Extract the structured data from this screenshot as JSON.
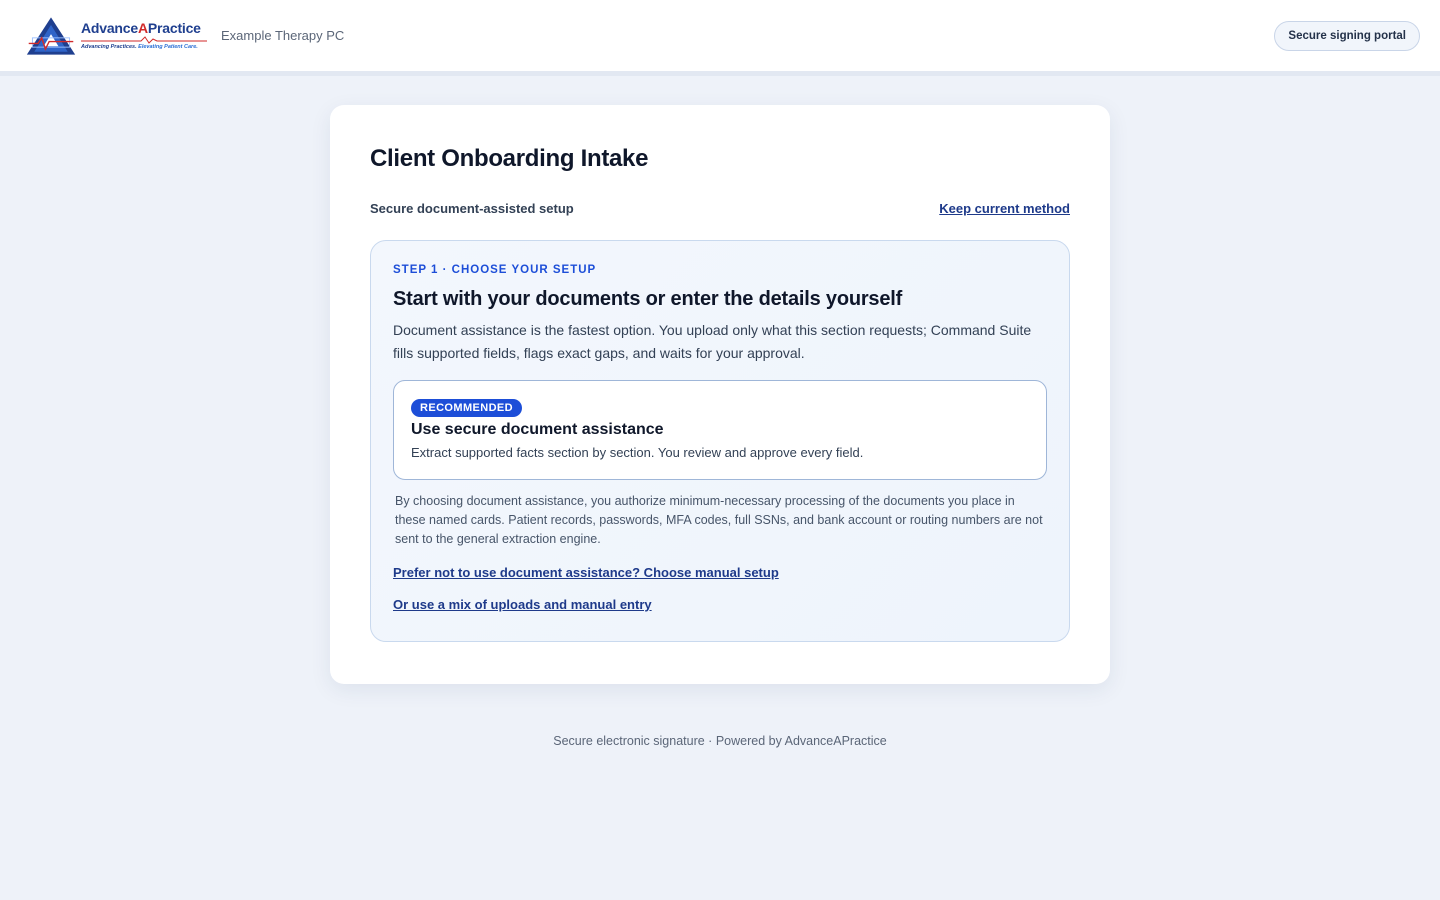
{
  "header": {
    "logo": {
      "name_part1": "Advance",
      "name_part2": "A",
      "name_part3": "Practice",
      "tagline_part1": "Advancing Practices.",
      "tagline_part2": "Elevating Patient Care."
    },
    "org_name": "Example Therapy PC",
    "portal_badge": "Secure signing portal"
  },
  "card": {
    "title": "Client Onboarding Intake",
    "subhead": "Secure document-assisted setup",
    "keep_link": "Keep current method",
    "step": {
      "label": "STEP 1 · CHOOSE YOUR SETUP",
      "heading": "Start with your documents or enter the details yourself",
      "description": "Document assistance is the fastest option. You upload only what this section requests; Command Suite fills supported fields, flags exact gaps, and waits for your approval.",
      "option": {
        "badge": "RECOMMENDED",
        "title": "Use secure document assistance",
        "description": "Extract supported facts section by section. You review and approve every field."
      },
      "consent": "By choosing document assistance, you authorize minimum-necessary processing of the documents you place in these named cards. Patient records, passwords, MFA codes, full SSNs, and bank account or routing numbers are not sent to the general extraction engine.",
      "manual_link": "Prefer not to use document assistance? Choose manual setup",
      "mix_link": "Or use a mix of uploads and manual entry"
    }
  },
  "footer": {
    "text": "Secure electronic signature · Powered by AdvanceAPractice"
  },
  "colors": {
    "accent": "#1d4ed8",
    "link": "#1e3a8a",
    "page_bg": "#eef2f9",
    "logo_red": "#d12a2a"
  }
}
